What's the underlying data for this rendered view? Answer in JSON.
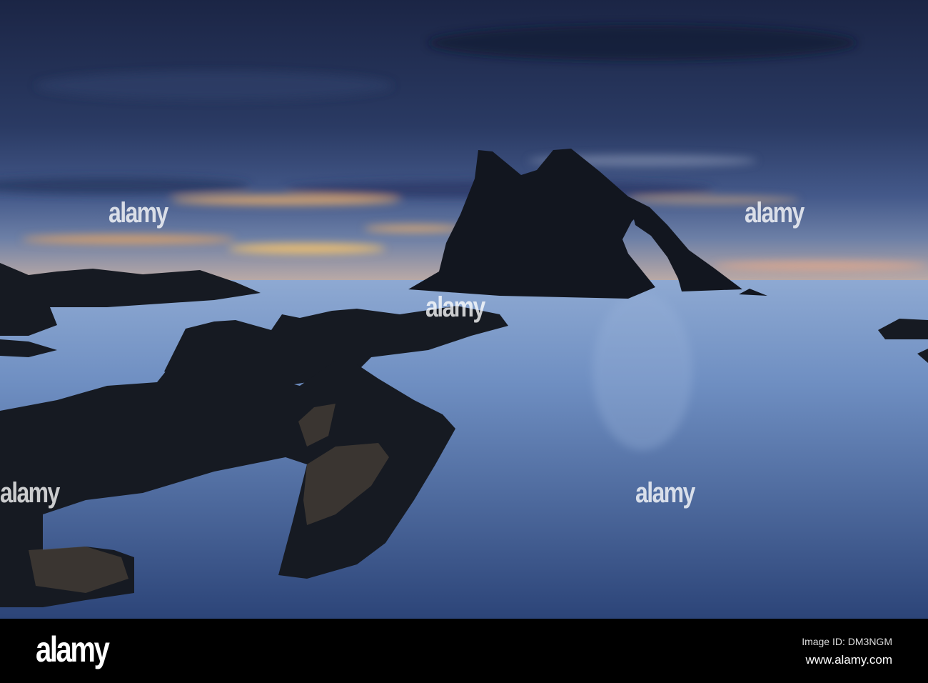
{
  "image": {
    "description_title": "Sea arch at dusk",
    "colors": {
      "sky_top": "#1b2545",
      "sky_band": "#3b5079",
      "glow": "#f2b36a",
      "sea_light": "#8ba6cf",
      "sea_dark": "#2f4a80",
      "rock": "#12161f"
    }
  },
  "watermark": {
    "text": "alamy"
  },
  "footer": {
    "logo": "alamy",
    "image_id": "Image ID: DM3NGM",
    "website": "www.alamy.com"
  }
}
